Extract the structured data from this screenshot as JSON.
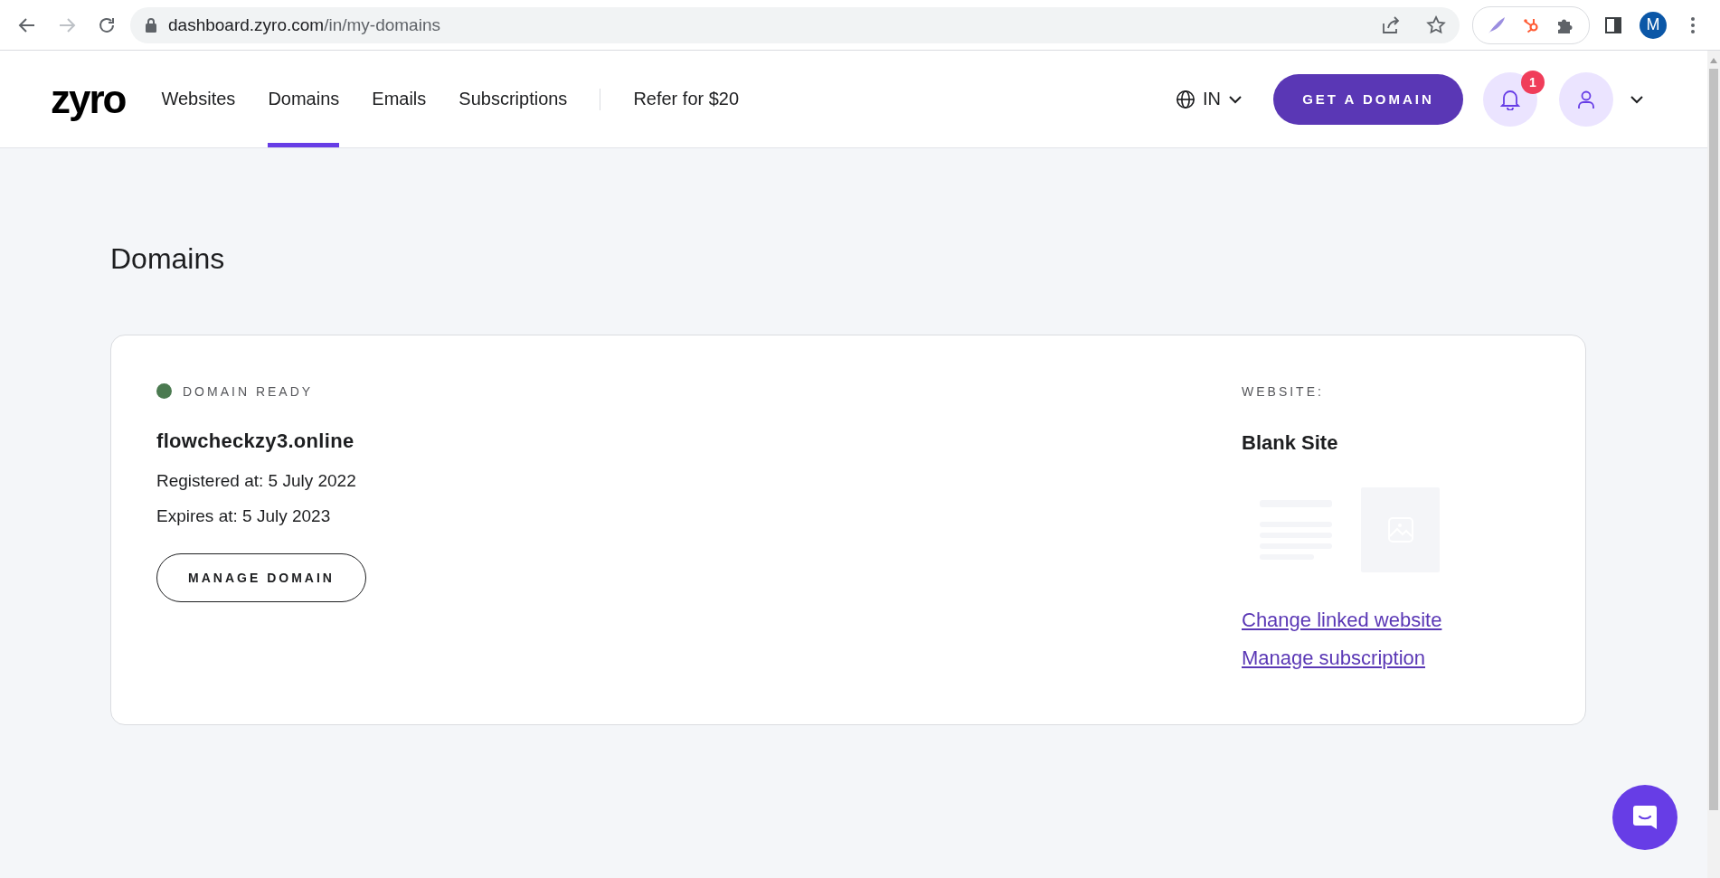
{
  "browser": {
    "url_host": "dashboard.zyro.com",
    "url_path": "/in/my-domains",
    "profile_initial": "M"
  },
  "header": {
    "logo": "zyro",
    "nav": [
      {
        "label": "Websites",
        "selected": false
      },
      {
        "label": "Domains",
        "selected": true
      },
      {
        "label": "Emails",
        "selected": false
      },
      {
        "label": "Subscriptions",
        "selected": false
      }
    ],
    "refer": "Refer for $20",
    "region": "IN",
    "cta": "GET A DOMAIN",
    "notification_count": "1"
  },
  "page_title": "Domains",
  "domains": [
    {
      "status": "DOMAIN READY",
      "color": "#4b7a50",
      "name": "flowcheckzy3.online",
      "registered": "Registered at: 5 July 2022",
      "expires": "Expires at: 5 July 2023",
      "action": "MANAGE DOMAIN",
      "website_label": "WEBSITE:",
      "website_name": "Blank Site",
      "links": [
        "Change linked website",
        "Manage subscription"
      ]
    }
  ]
}
